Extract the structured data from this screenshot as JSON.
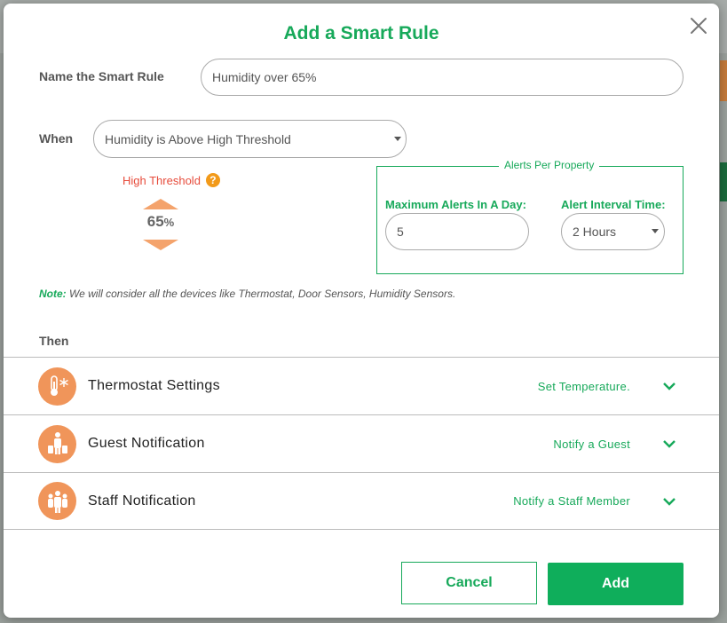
{
  "modal": {
    "title": "Add a Smart Rule",
    "close_icon": "close-icon"
  },
  "name_field": {
    "label": "Name the Smart Rule",
    "value": "Humidity over 65%"
  },
  "when_field": {
    "label": "When",
    "selected": "Humidity is Above High Threshold"
  },
  "threshold": {
    "label": "High Threshold",
    "help_icon": "?",
    "value": "65",
    "unit": "%"
  },
  "alerts": {
    "legend": "Alerts Per Property",
    "max_label": "Maximum Alerts In A Day:",
    "max_value": "5",
    "interval_label": "Alert Interval Time:",
    "interval_selected": "2 Hours"
  },
  "note": {
    "prefix": "Note:",
    "text": " We will consider all the devices like Thermostat, Door Sensors, Humidity Sensors."
  },
  "then_label": "Then",
  "actions": [
    {
      "title": "Thermostat Settings",
      "subtitle": "Set Temperature.",
      "icon": "thermostat-icon"
    },
    {
      "title": "Guest Notification",
      "subtitle": "Notify a Guest",
      "icon": "guest-icon"
    },
    {
      "title": "Staff Notification",
      "subtitle": "Notify a Staff Member",
      "icon": "staff-icon"
    }
  ],
  "buttons": {
    "cancel": "Cancel",
    "add": "Add"
  },
  "colors": {
    "accent_green": "#17a95a",
    "icon_orange": "#f0955a",
    "threshold_red": "#e74c3c"
  }
}
